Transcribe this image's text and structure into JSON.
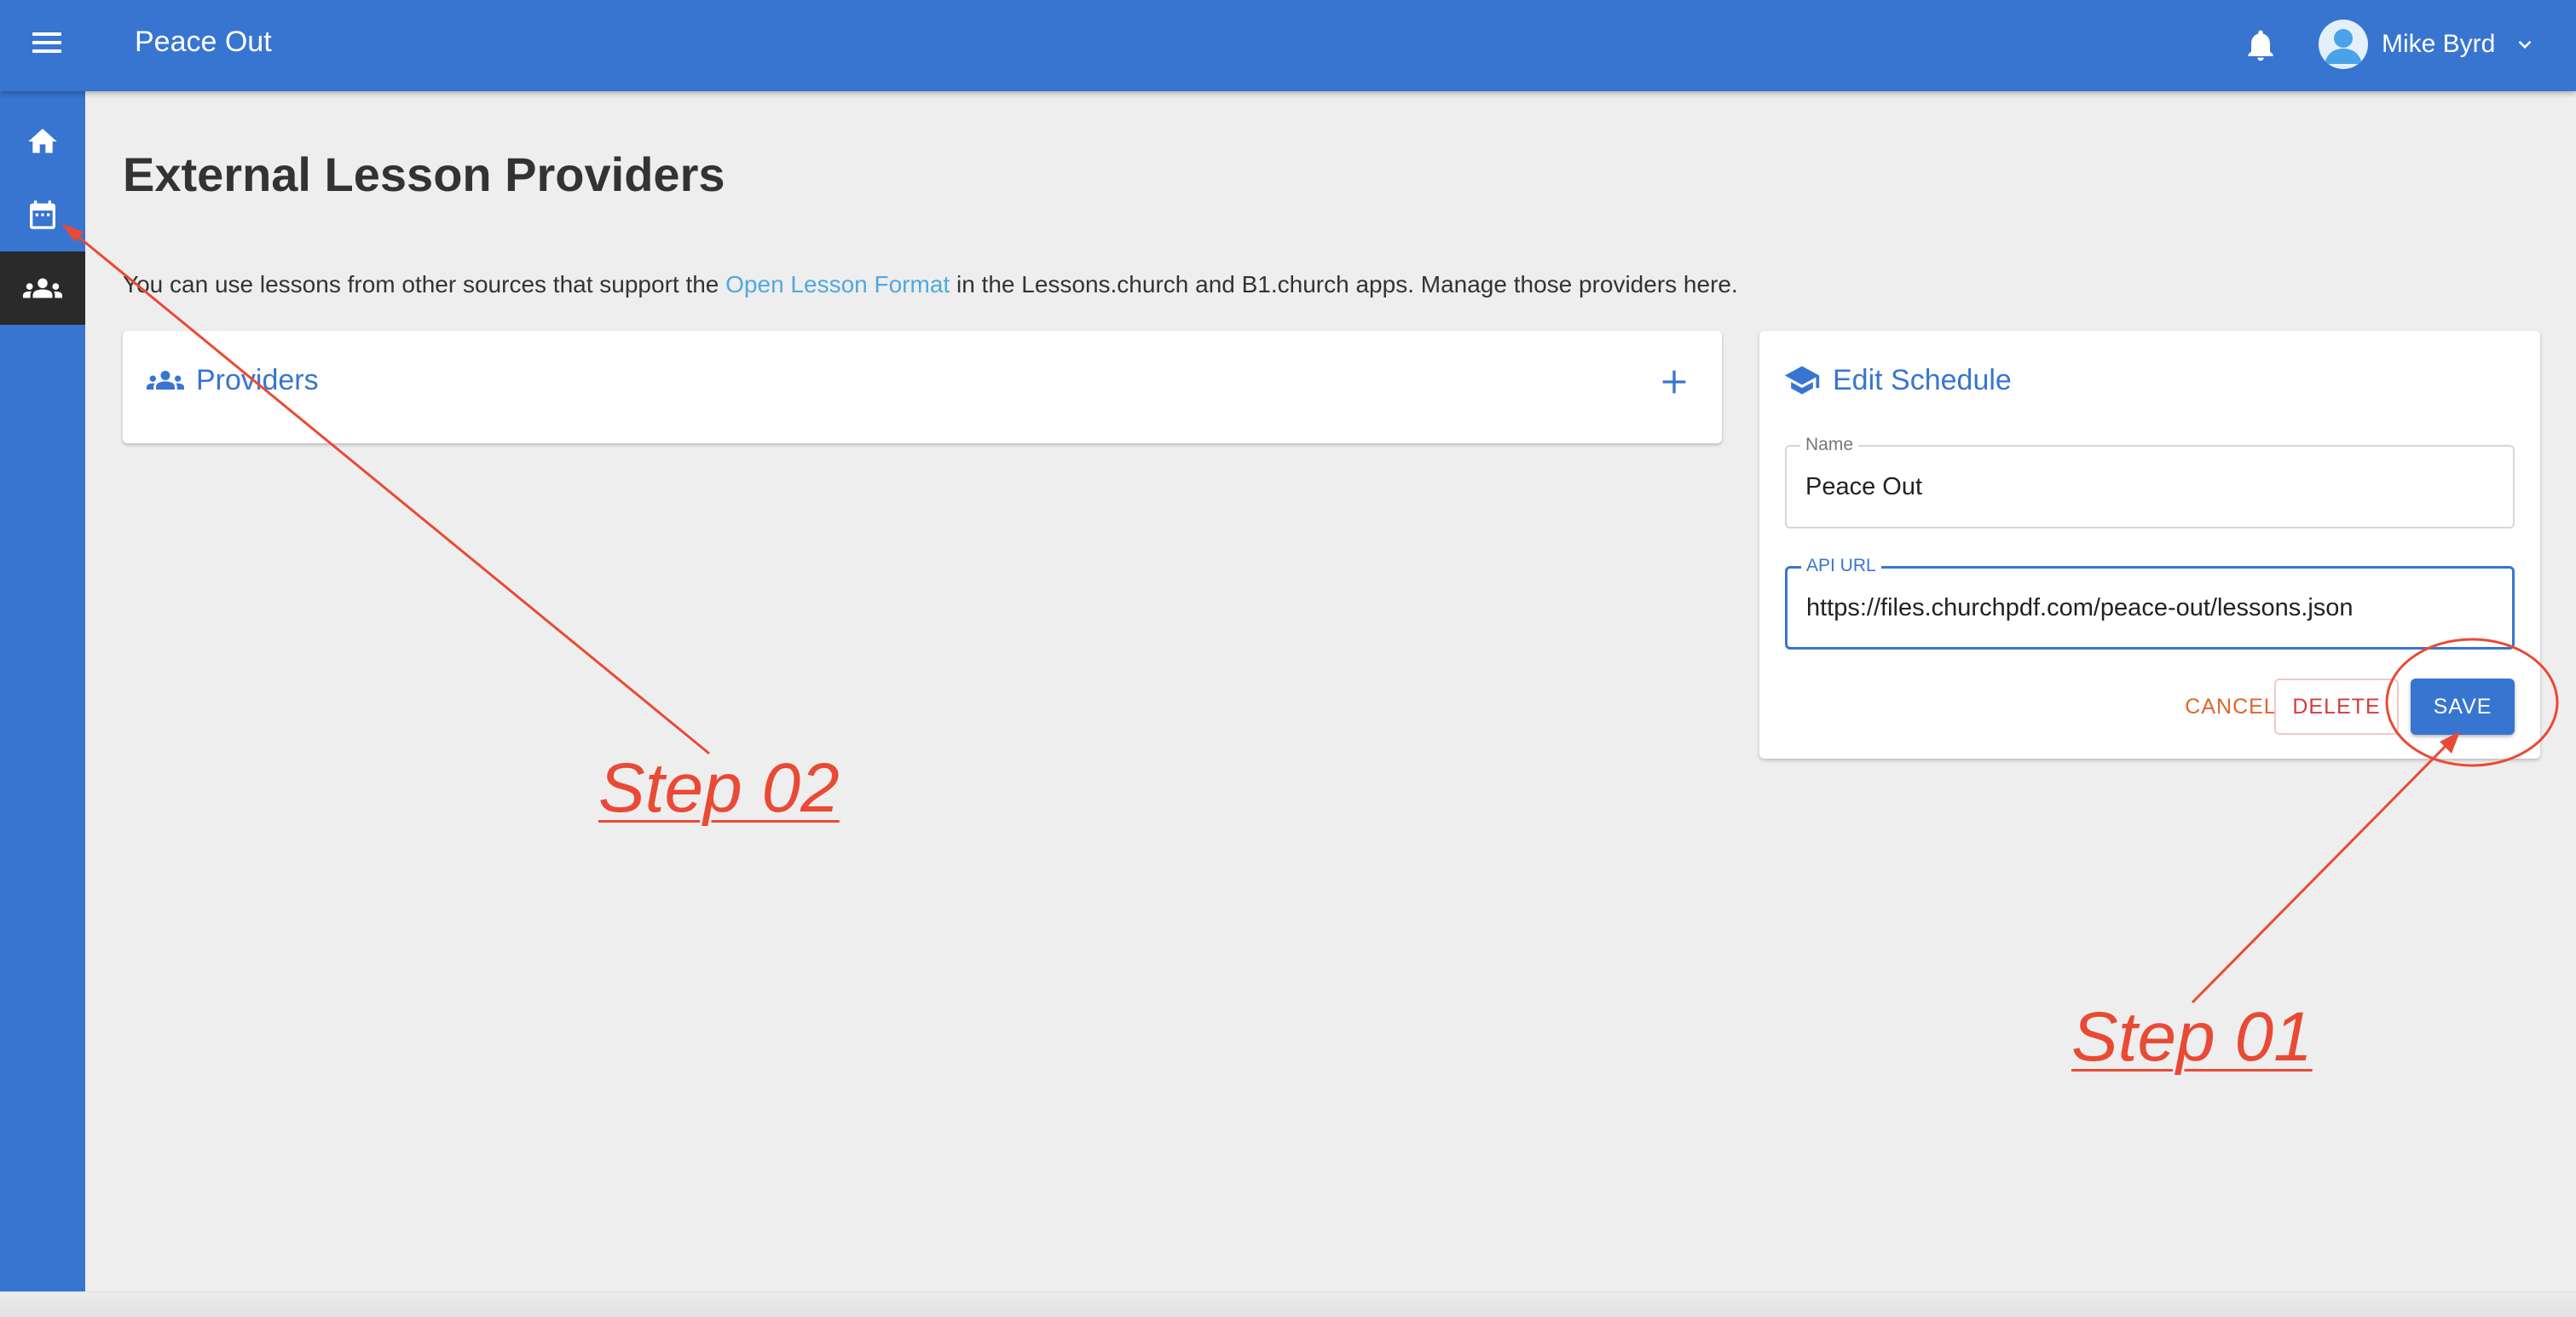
{
  "appbar": {
    "title": "Peace Out",
    "user_name": "Mike Byrd"
  },
  "sidebar": {
    "items": [
      {
        "name": "home",
        "icon": "home-icon"
      },
      {
        "name": "calendar",
        "icon": "calendar-icon"
      },
      {
        "name": "people",
        "icon": "people-icon",
        "active": true
      }
    ]
  },
  "page": {
    "title": "External Lesson Providers",
    "intro_before": "You can use lessons from other sources that support the ",
    "intro_link": "Open Lesson Format",
    "intro_after": " in the Lessons.church and B1.church apps. Manage those providers here."
  },
  "providers_card": {
    "title": "Providers",
    "add_icon": "plus-icon"
  },
  "edit_card": {
    "title": "Edit Schedule",
    "name_label": "Name",
    "name_value": "Peace Out",
    "url_label": "API URL",
    "url_value": "https://files.churchpdf.com/peace-out/lessons.json",
    "cancel_label": "CANCEL",
    "delete_label": "DELETE",
    "save_label": "SAVE"
  },
  "annotations": {
    "step1": "Step 01",
    "step2": "Step 02"
  },
  "colors": {
    "primary": "#3875d0",
    "cancel": "#e0652a",
    "delete": "#d63b3b",
    "annotation": "#e94a35",
    "link": "#50a8e0"
  }
}
